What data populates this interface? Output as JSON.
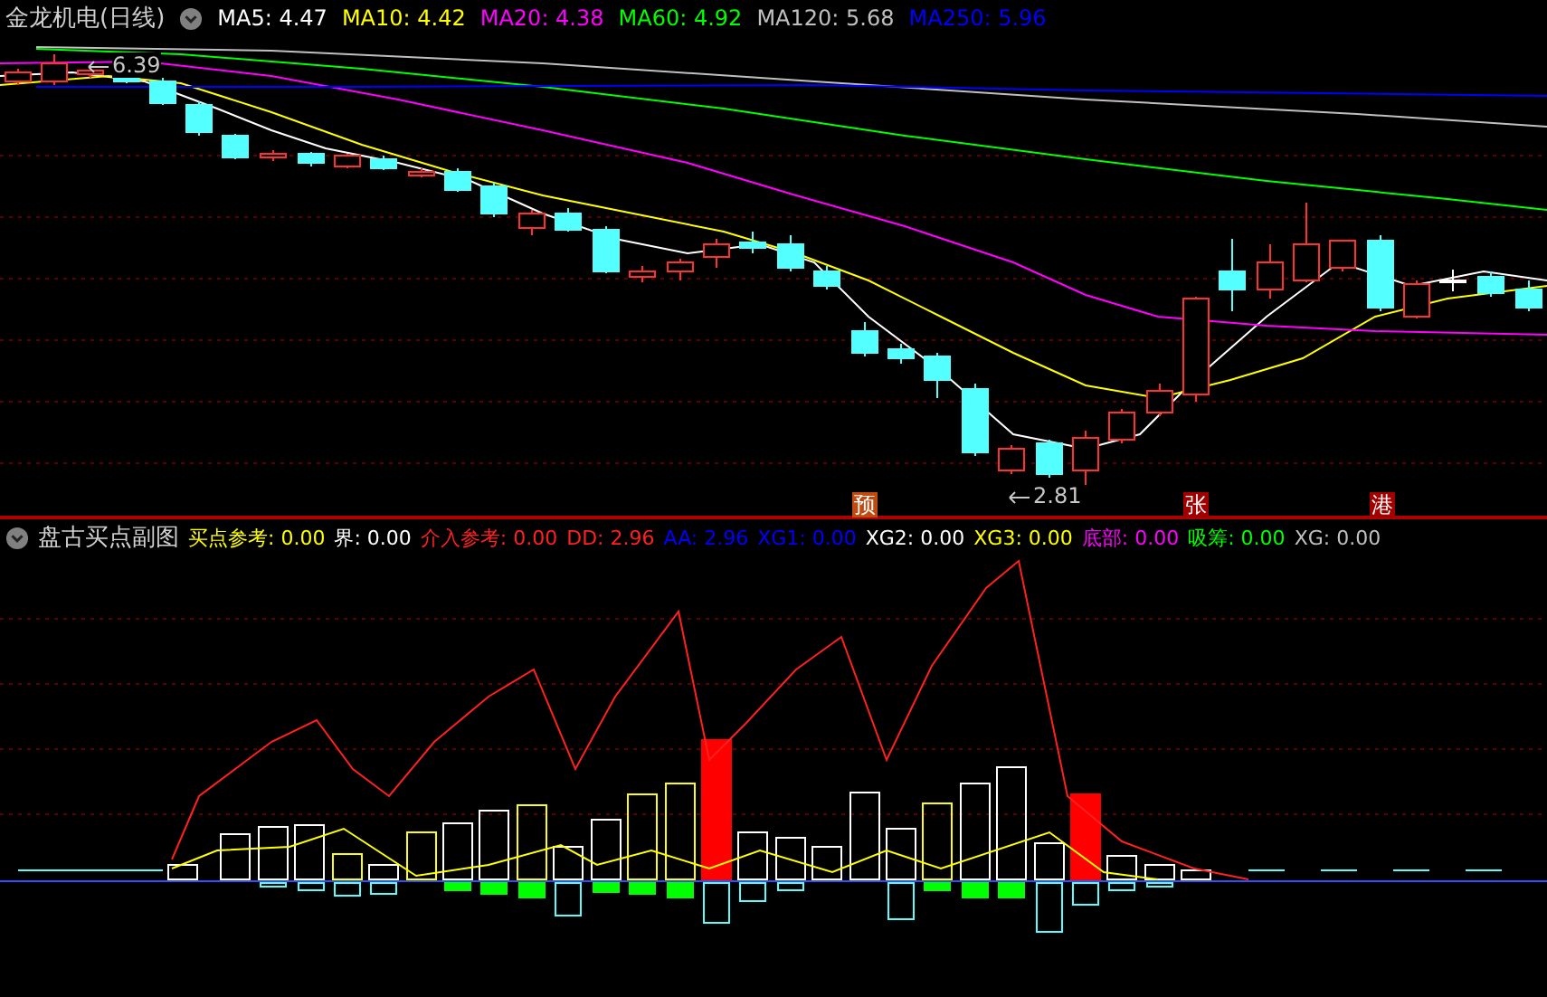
{
  "main_chart": {
    "title": "金龙机电(日线)",
    "indicators": [
      {
        "label": "MA5:",
        "value": "4.47",
        "color": "#ffffff"
      },
      {
        "label": "MA10:",
        "value": "4.42",
        "color": "#ffff00"
      },
      {
        "label": "MA20:",
        "value": "4.38",
        "color": "#ff00ff"
      },
      {
        "label": "MA60:",
        "value": "4.92",
        "color": "#00ff00"
      },
      {
        "label": "MA120:",
        "value": "5.68",
        "color": "#c0c0c0"
      },
      {
        "label": "MA250:",
        "value": "5.96",
        "color": "#0000ff"
      }
    ],
    "price_notes": [
      {
        "text": "6.39"
      },
      {
        "text": "2.81"
      }
    ],
    "signals": [
      {
        "text": "预",
        "color": "#c04a10"
      },
      {
        "text": "张",
        "color": "#a00000"
      },
      {
        "text": "港",
        "color": "#a00000"
      }
    ]
  },
  "sub_chart": {
    "title": "盘古买点副图",
    "indicators": [
      {
        "label": "买点参考:",
        "value": "0.00",
        "color": "#ffff00"
      },
      {
        "label": "界:",
        "value": "0.00",
        "color": "#ffffff"
      },
      {
        "label": "介入参考:",
        "value": "0.00",
        "color": "#ff2020"
      },
      {
        "label": "DD:",
        "value": "2.96",
        "color": "#ff2020"
      },
      {
        "label": "AA:",
        "value": "2.96",
        "color": "#0000ff"
      },
      {
        "label": "XG1:",
        "value": "0.00",
        "color": "#0000ff"
      },
      {
        "label": "XG2:",
        "value": "0.00",
        "color": "#ffffff"
      },
      {
        "label": "XG3:",
        "value": "0.00",
        "color": "#ffff00"
      },
      {
        "label": "底部:",
        "value": "0.00",
        "color": "#ff00ff"
      },
      {
        "label": "吸筹:",
        "value": "0.00",
        "color": "#00ff00"
      },
      {
        "label": "XG:",
        "value": "0.00",
        "color": "#c0c0c0"
      }
    ]
  }
}
